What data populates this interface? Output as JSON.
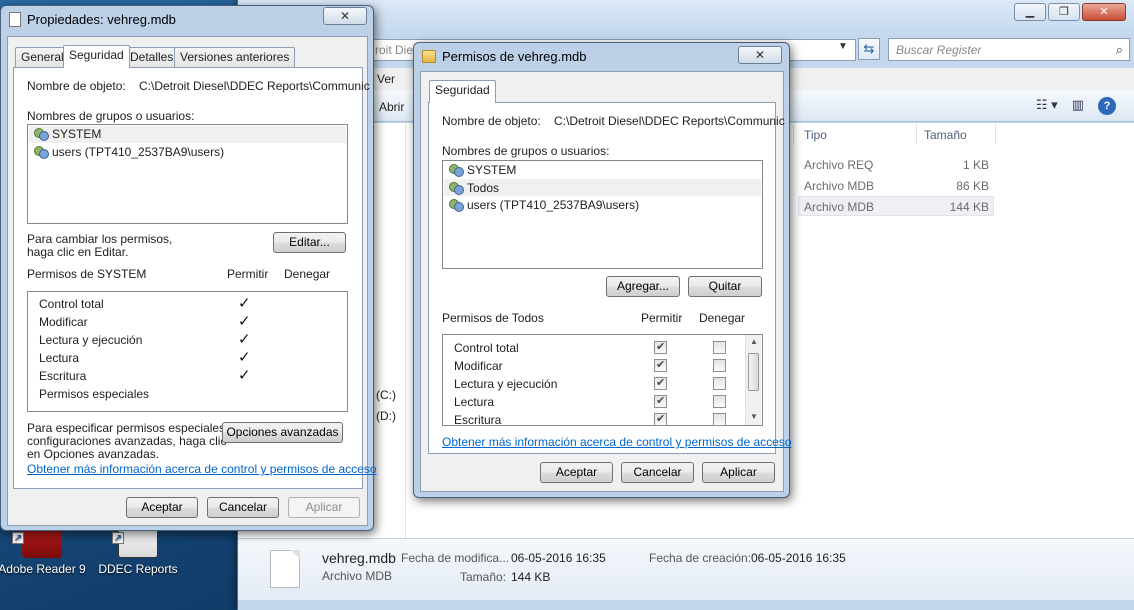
{
  "desktop": {
    "icons": [
      {
        "label": "Adobe Reader 9"
      },
      {
        "label": "DDEC Reports"
      }
    ]
  },
  "explorer": {
    "address_fragment": "roit Die",
    "search_placeholder": "Buscar Register",
    "menu_view": "Ver",
    "toolbar_open": "Abrir",
    "columns": {
      "type": "Tipo",
      "size": "Tamaño"
    },
    "rows": [
      {
        "type": "Archivo REQ",
        "size": "1 KB"
      },
      {
        "type": "Archivo MDB",
        "size": "86 KB"
      },
      {
        "type": "Archivo MDB",
        "size": "144 KB"
      }
    ],
    "drives": [
      "(C:)",
      "(D:)"
    ],
    "details": {
      "filename": "vehreg.mdb",
      "filetype": "Archivo MDB",
      "modified_label": "Fecha de modifica...",
      "modified_value": "06-05-2016 16:35",
      "created_label": "Fecha de creación:",
      "created_value": "06-05-2016 16:35",
      "size_label": "Tamaño:",
      "size_value": "144 KB"
    }
  },
  "props": {
    "title": "Propiedades: vehreg.mdb",
    "tabs": [
      "General",
      "Seguridad",
      "Detalles",
      "Versiones anteriores"
    ],
    "object_label": "Nombre de objeto:",
    "object_value": "C:\\Detroit Diesel\\DDEC Reports\\Communic",
    "groups_label": "Nombres de grupos o usuarios:",
    "users": [
      "SYSTEM",
      "users (TPT410_2537BA9\\users)"
    ],
    "change_hint_1": "Para cambiar los permisos,",
    "change_hint_2": "haga clic en Editar.",
    "edit_button": "Editar...",
    "perm_header": "Permisos de SYSTEM",
    "allow_header": "Permitir",
    "deny_header": "Denegar",
    "permissions": [
      "Control total",
      "Modificar",
      "Lectura y ejecución",
      "Lectura",
      "Escritura",
      "Permisos especiales"
    ],
    "advanced_hint_1": "Para especificar permisos especiales o",
    "advanced_hint_2": "configuraciones avanzadas, haga clic",
    "advanced_hint_3": "en Opciones avanzadas.",
    "advanced_button": "Opciones avanzadas",
    "link": "Obtener más información acerca de control y permisos de acceso",
    "ok": "Aceptar",
    "cancel": "Cancelar",
    "apply": "Aplicar"
  },
  "perms": {
    "title": "Permisos de vehreg.mdb",
    "tab": "Seguridad",
    "object_label": "Nombre de objeto:",
    "object_value": "C:\\Detroit Diesel\\DDEC Reports\\Communic",
    "groups_label": "Nombres de grupos o usuarios:",
    "users": [
      "SYSTEM",
      "Todos",
      "users (TPT410_2537BA9\\users)"
    ],
    "add_button": "Agregar...",
    "remove_button": "Quitar",
    "perm_header": "Permisos de Todos",
    "allow_header": "Permitir",
    "deny_header": "Denegar",
    "permissions": [
      "Control total",
      "Modificar",
      "Lectura y ejecución",
      "Lectura",
      "Escritura"
    ],
    "link": "Obtener más información acerca de control y permisos de acceso",
    "ok": "Aceptar",
    "cancel": "Cancelar",
    "apply": "Aplicar"
  }
}
